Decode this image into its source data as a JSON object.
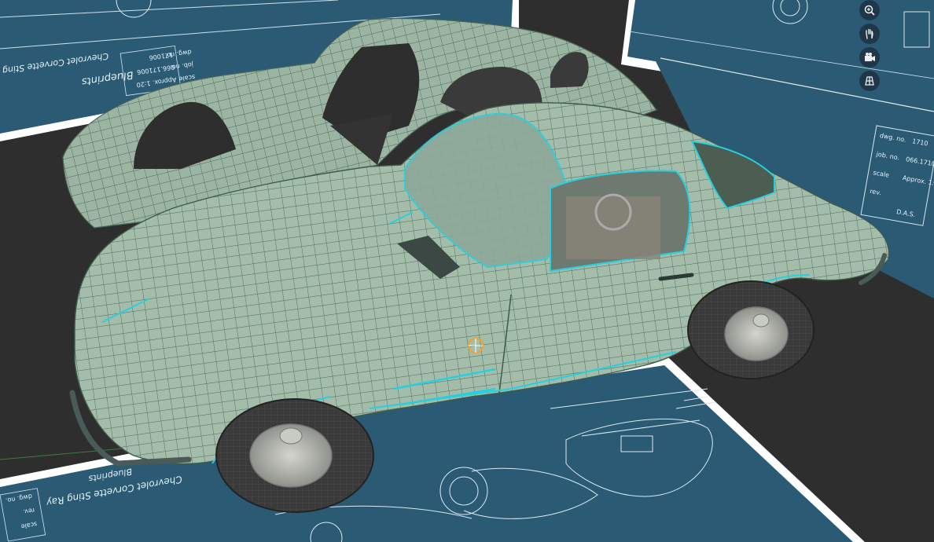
{
  "viewport": {
    "background_color": "#2e2e2e",
    "blueprint_color": "#2b5a74",
    "mesh_color": "#9fb9a8",
    "edge_highlight_color": "#25d0e0"
  },
  "blueprint_left": {
    "title": "Chevrolet Corvette Sting Ray",
    "brand": "Blueprints",
    "rows": [
      {
        "label": "dwg. no.",
        "value": "171006"
      },
      {
        "label": "job. no.",
        "value": "066.171006"
      },
      {
        "label": "scale",
        "value": "Approx. 1:20"
      }
    ]
  },
  "blueprint_right": {
    "rows": [
      {
        "label": "dwg. no.",
        "value": "1710"
      },
      {
        "label": "job. no.",
        "value": "066.1710"
      },
      {
        "label": "scale",
        "value": "Approx. 1:2"
      },
      {
        "label": "rev.",
        "value": ""
      },
      {
        "label": "",
        "value": "D.A.S."
      }
    ]
  },
  "blueprint_bottom": {
    "title": "Chevrolet Corvette Sting Ray",
    "brand": "Blueprints",
    "rows": [
      {
        "label": "dwg. no.",
        "value": ""
      },
      {
        "label": "rev.",
        "value": ""
      },
      {
        "label": "scale",
        "value": ""
      }
    ]
  },
  "nav": [
    {
      "icon": "zoom-icon"
    },
    {
      "icon": "pan-hand-icon"
    },
    {
      "icon": "camera-icon"
    },
    {
      "icon": "grid-view-icon"
    }
  ]
}
